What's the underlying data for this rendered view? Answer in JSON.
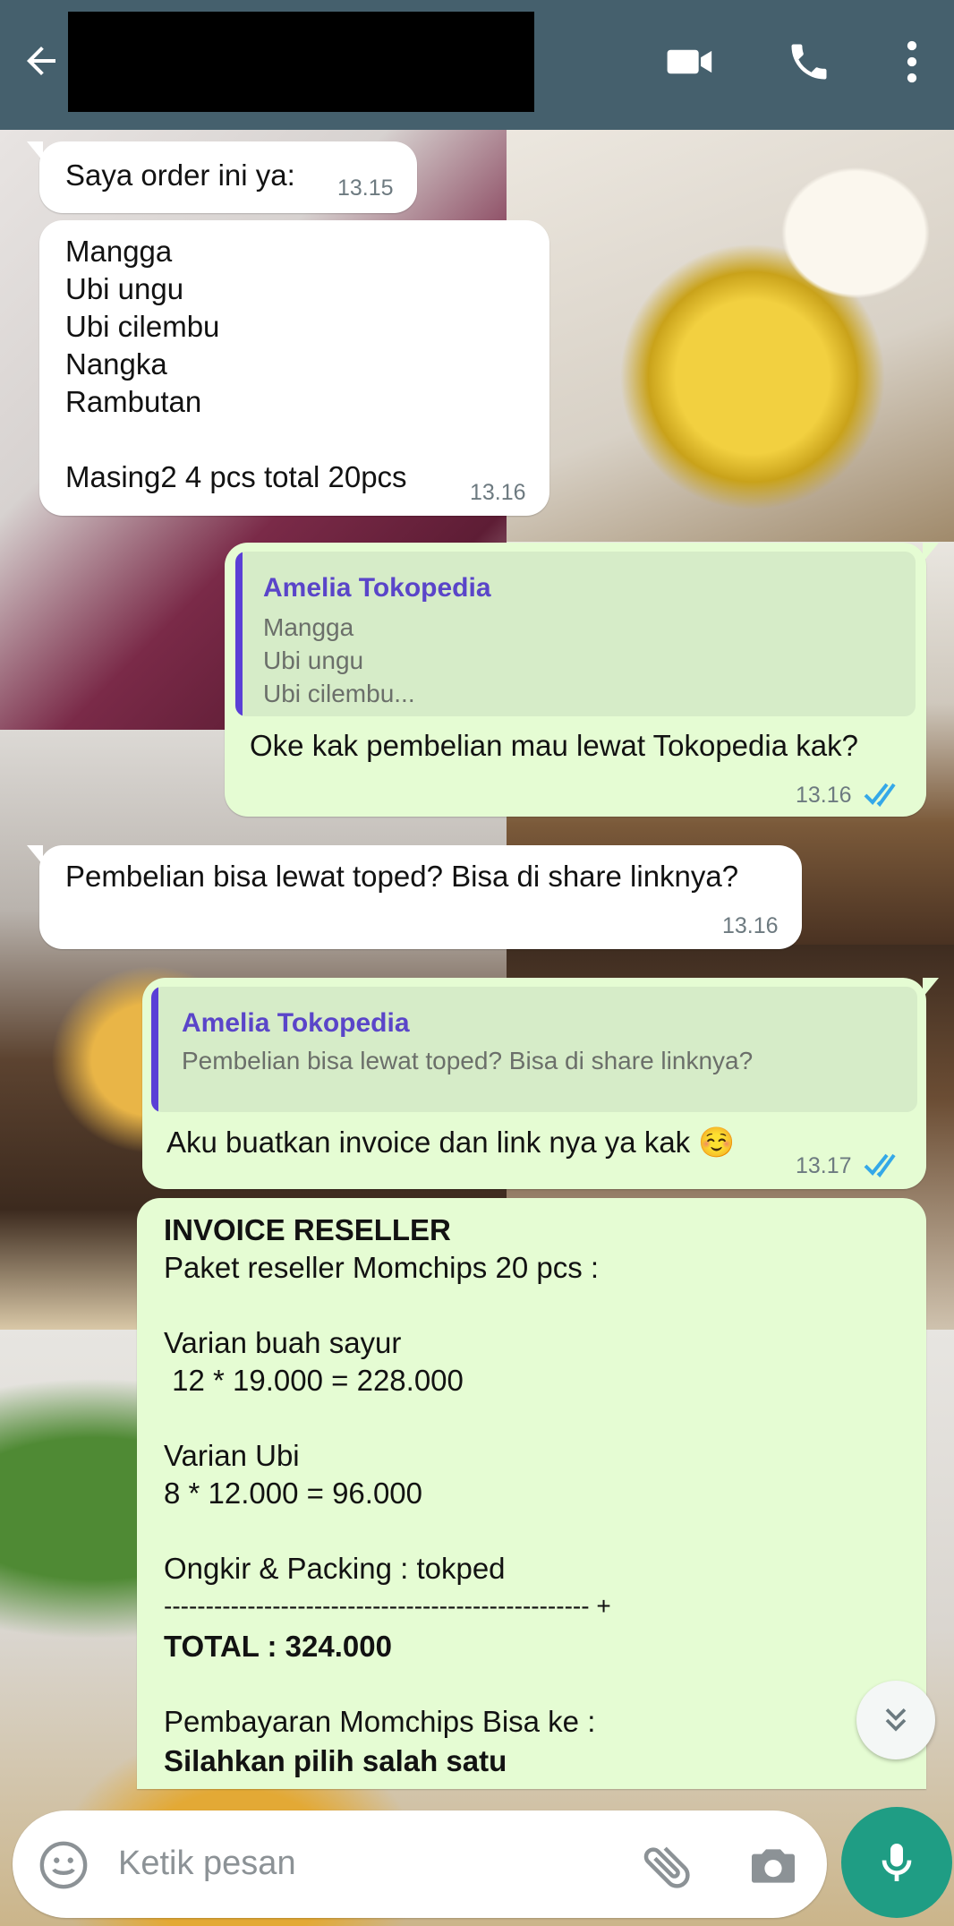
{
  "header": {
    "contact_name": "",
    "icons": [
      "back-arrow-icon",
      "video-call-icon",
      "phone-call-icon",
      "more-options-icon"
    ],
    "background_color": "#45606d"
  },
  "messages": {
    "m1": {
      "text": "Saya order ini ya:",
      "time": "13.15"
    },
    "m2": {
      "lines": [
        "Mangga",
        "Ubi ungu",
        "Ubi cilembu",
        "Nangka",
        "Rambutan",
        "",
        "Masing2 4 pcs total 20pcs"
      ],
      "time": "13.16"
    },
    "m3": {
      "quote_name": "Amelia Tokopedia",
      "quote_lines": [
        "Mangga",
        "Ubi ungu",
        "Ubi cilembu..."
      ],
      "text": "Oke kak pembelian mau lewat Tokopedia kak?",
      "time": "13.16"
    },
    "m4": {
      "text": "Pembelian bisa lewat toped? Bisa di share linknya?",
      "time": "13.16"
    },
    "m5": {
      "quote_name": "Amelia Tokopedia",
      "quote_text": "Pembelian bisa lewat toped? Bisa di share linknya?",
      "text": "Aku buatkan invoice dan link nya ya kak ☺️",
      "time": "13.17"
    },
    "m6": {
      "l1": "INVOICE RESELLER",
      "l2": "Paket reseller Momchips 20 pcs :",
      "l3": "Varian buah sayur",
      "l4": " 12 * 19.000 = 228.000",
      "l5": "Varian Ubi",
      "l6": "8 * 12.000 = 96.000",
      "l7": "Ongkir & Packing : tokped",
      "l8": "--------------------------------------------------- +",
      "l9": "TOTAL : 324.000",
      "l10": "Pembayaran Momchips Bisa ke :",
      "l11": "Silahkan pilih salah satu"
    }
  },
  "input": {
    "placeholder": "Ketik pesan",
    "icons": [
      "emoji-icon",
      "attach-icon",
      "camera-icon",
      "mic-icon"
    ]
  },
  "colors": {
    "incoming_bubble": "#ffffff",
    "outgoing_bubble": "#e5fcd3",
    "quote_bar": "#5a3fd6",
    "read_ticks": "#34a8e8",
    "mic_button": "#1f9d84"
  }
}
